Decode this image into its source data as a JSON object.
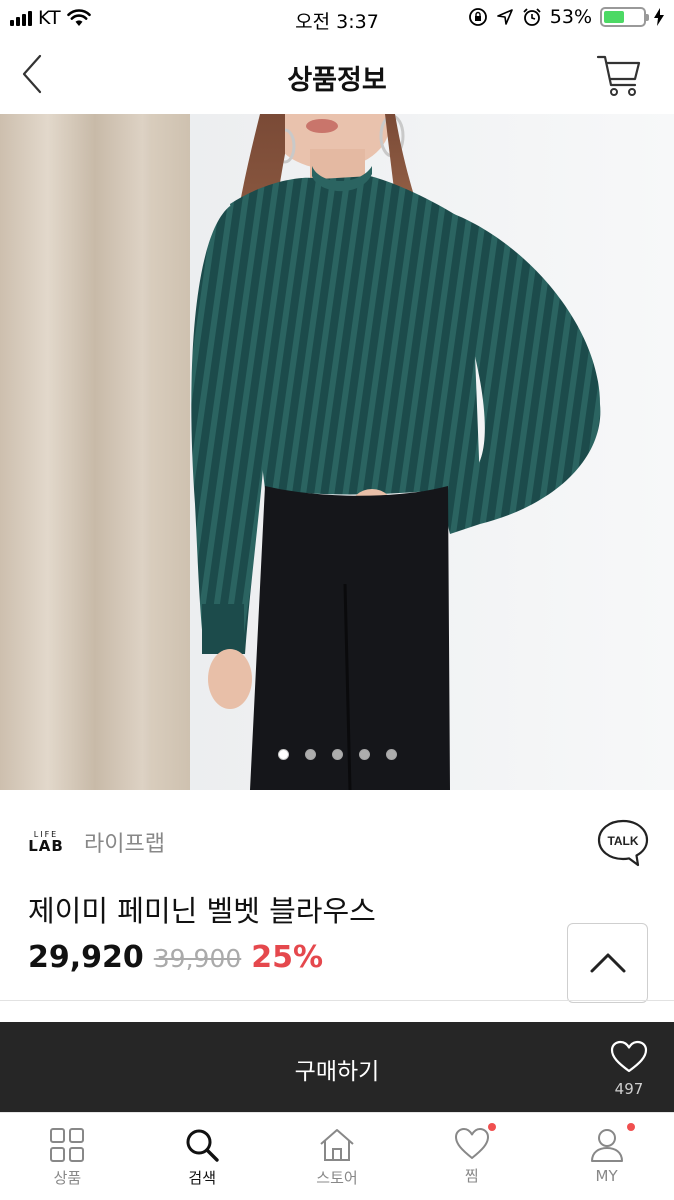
{
  "status_bar": {
    "carrier": "KT",
    "time": "오전 3:37",
    "battery": "53%",
    "battery_level": 0.53
  },
  "header": {
    "title": "상품정보"
  },
  "hero": {
    "total_images": 5,
    "active_index": 0
  },
  "product": {
    "brand_logo_top": "LIFE",
    "brand_logo_bottom": "LAB",
    "brand_name": "라이프랩",
    "talk_label": "TALK",
    "title": "제이미 페미닌 벨벳 블라우스",
    "price": "29,920",
    "original_price": "39,900",
    "discount": "25%"
  },
  "buy_bar": {
    "buy_label": "구매하기",
    "like_count": "497"
  },
  "tab_bar": {
    "items": [
      {
        "label": "상품"
      },
      {
        "label": "검색"
      },
      {
        "label": "스토어"
      },
      {
        "label": "찜"
      },
      {
        "label": "MY"
      }
    ]
  },
  "colors": {
    "accent_red": "#e5484d",
    "buy_bar": "#262626",
    "battery_green": "#4cd964"
  }
}
